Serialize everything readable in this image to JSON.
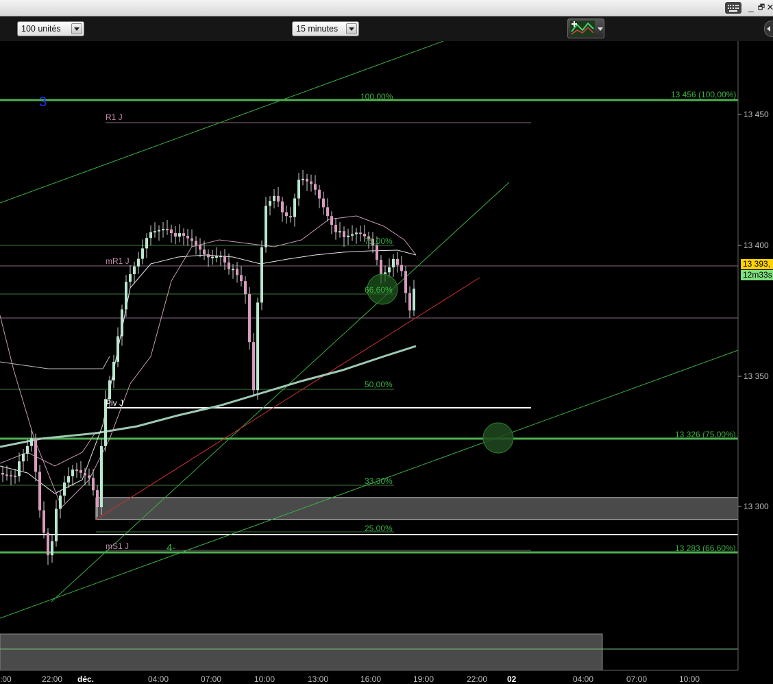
{
  "toolbar": {
    "units_select": "100 unités",
    "interval_select": "15 minutes",
    "indicator_button_icon": "indicator-icon"
  },
  "window": {
    "keyboard_icon": "keyboard-icon",
    "minimize": "_",
    "restore": "🗗",
    "close": "✕"
  },
  "chart_labels": {
    "wave_3": "3",
    "wave_4": "4-",
    "fib_100": "100,00%",
    "fib_75": "75,00%",
    "fib_66": "66,60%",
    "fib_50": "50,00%",
    "fib_33": "33,30%",
    "fib_25": "25,00%",
    "r1j": "R1 J",
    "mr1j": "mR1 J",
    "pivj": "Piv J",
    "ms1j": "mS1 J",
    "line_100": "13 456 (100,00%)",
    "line_75": "13 326 (75,00%)",
    "line_66": "13 283 (66,60%)",
    "current_price": "13 393,",
    "countdown": "12m33s"
  },
  "chart_data": {
    "type": "candlestick",
    "instrument": "",
    "interval": "15 minutes",
    "ylim": [
      13247,
      13477
    ],
    "y_ticks": [
      "13 450",
      "13 400",
      "13 350",
      "13 300"
    ],
    "y_tick_values": [
      13450,
      13400,
      13350,
      13300
    ],
    "x_ticks": [
      ":00",
      "22:00",
      "déc.",
      "04:00",
      "07:00",
      "10:00",
      "13:00",
      "16:00",
      "19:00",
      "22:00",
      "02",
      "04:00",
      "07:00",
      "10:00"
    ],
    "horizontal_levels": [
      {
        "label": "13 456 (100,00%)",
        "value": 13456,
        "color": "#4caf50"
      },
      {
        "label": "13 326 (75,00%)",
        "value": 13326,
        "color": "#4caf50"
      },
      {
        "label": "13 283 (66,60%)",
        "value": 13283,
        "color": "#4caf50"
      },
      {
        "label": "R1 J",
        "value": 13447,
        "color": "#b07a9a"
      },
      {
        "label": "mR1 J",
        "value": 13392,
        "color": "#b07a9a"
      },
      {
        "label": "Piv J",
        "value": 13338,
        "color": "#ffffff"
      },
      {
        "label": "mS1 J",
        "value": 13284,
        "color": "#b07a9a"
      }
    ],
    "fib_levels": [
      {
        "label": "100,00%",
        "value": 13457
      },
      {
        "label": "75,00%",
        "value": 13397
      },
      {
        "label": "66,60%",
        "value": 13379
      },
      {
        "label": "50,00%",
        "value": 13344
      },
      {
        "label": "33,30%",
        "value": 13308
      },
      {
        "label": "25,00%",
        "value": 13289
      }
    ],
    "current_price": 13393
  }
}
